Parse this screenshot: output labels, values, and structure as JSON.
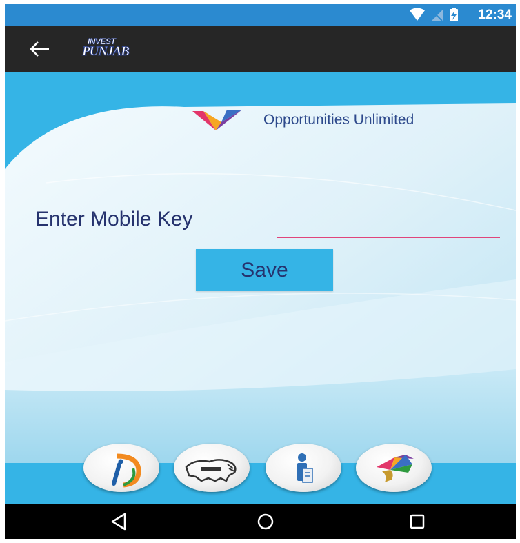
{
  "status_bar": {
    "time": "12:34",
    "icons": [
      "wifi-icon",
      "signal-off-icon",
      "battery-charging-icon"
    ]
  },
  "app_bar": {
    "back_icon": "arrow-back-icon",
    "logo_top": "INVEST",
    "logo_bottom": "PUNJAB"
  },
  "brand": {
    "tagline": "Opportunities Unlimited"
  },
  "form": {
    "label": "Enter Mobile Key",
    "input_value": "",
    "input_placeholder": "",
    "save_label": "Save"
  },
  "bottom_icons": [
    "digital-india-icon",
    "make-in-india-lion-icon",
    "document-person-icon",
    "colorful-emblem-icon"
  ],
  "nav": [
    "back-triangle-icon",
    "home-circle-icon",
    "recents-square-icon"
  ],
  "colors": {
    "status_bar": "#2b8ad0",
    "app_bar": "#262626",
    "content_bg": "#35b4e6",
    "text_dark_blue": "#26336e",
    "input_underline": "#e0457b"
  }
}
